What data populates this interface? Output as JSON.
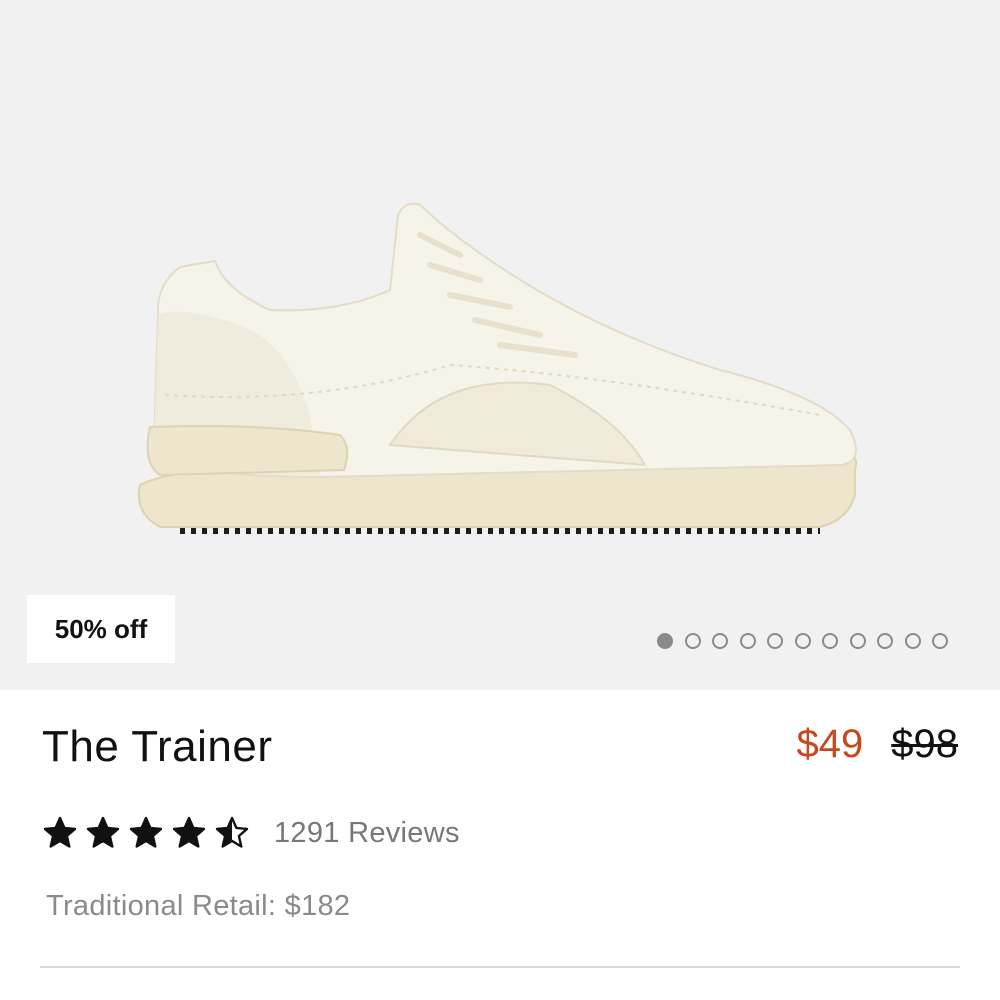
{
  "product": {
    "image_alt": "product-image-shoe",
    "discount_badge": "50% off",
    "gallery": {
      "total_images": 11,
      "active_index": 0
    },
    "title": "The Trainer",
    "sale_price": "$49",
    "original_price": "$98",
    "rating": {
      "value": 4.5,
      "max": 5
    },
    "reviews_label": "1291 Reviews",
    "traditional_retail": "Traditional Retail: $182"
  },
  "colors": {
    "sale_price": "#c9471e",
    "hero_background": "#f1f1f1",
    "shoe": "#f3efdf"
  }
}
